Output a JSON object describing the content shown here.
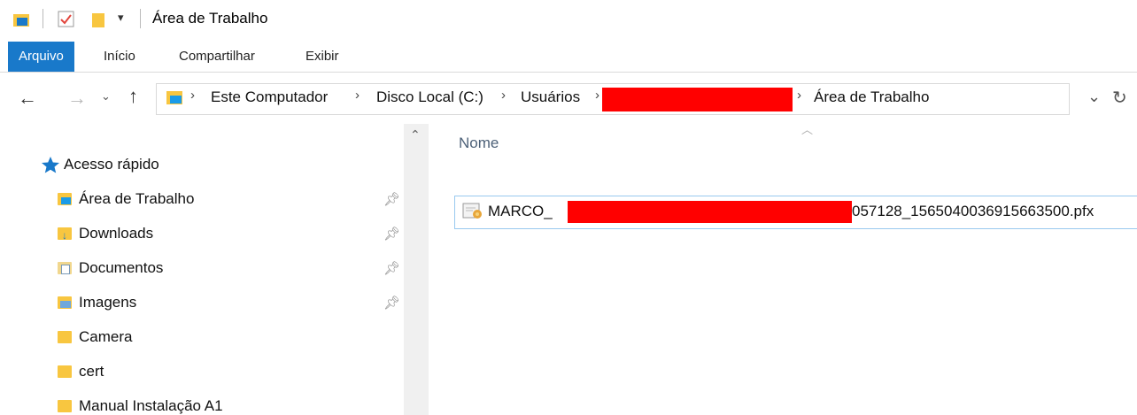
{
  "window": {
    "title": "Área de Trabalho"
  },
  "ribbon": {
    "tabs": [
      "Arquivo",
      "Início",
      "Compartilhar",
      "Exibir"
    ]
  },
  "address": {
    "breadcrumb": [
      "Este Computador",
      "Disco Local (C:)",
      "Usuários",
      "Área de Trabalho"
    ]
  },
  "sidebar": {
    "quick_access_label": "Acesso rápido",
    "items": [
      {
        "label": "Área de Trabalho",
        "icon": "desktop-folder-icon",
        "pinned": true
      },
      {
        "label": "Downloads",
        "icon": "downloads-folder-icon",
        "pinned": true
      },
      {
        "label": "Documentos",
        "icon": "documents-folder-icon",
        "pinned": true
      },
      {
        "label": "Imagens",
        "icon": "pictures-folder-icon",
        "pinned": true
      },
      {
        "label": "Camera",
        "icon": "folder-icon",
        "pinned": false
      },
      {
        "label": "cert",
        "icon": "folder-icon",
        "pinned": false
      },
      {
        "label": "Manual Instalação A1",
        "icon": "folder-icon",
        "pinned": false
      }
    ]
  },
  "content": {
    "column_name": "Nome",
    "files": [
      {
        "name_prefix": "MARCO_",
        "name_suffix": "057128_1565040036915663500.pfx",
        "icon": "certificate-file-icon"
      }
    ]
  },
  "colors": {
    "accent": "#1979ca",
    "redaction": "#ff0000",
    "folder": "#f8c640",
    "selection_border": "#99c9ef"
  }
}
